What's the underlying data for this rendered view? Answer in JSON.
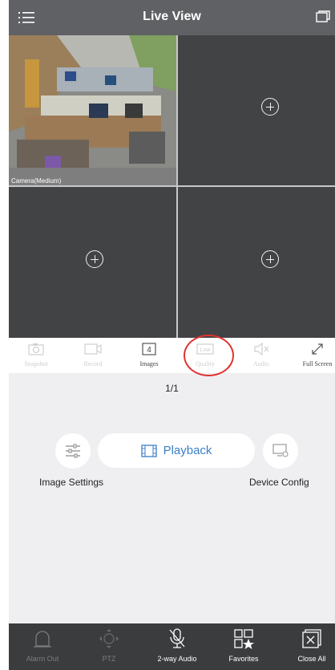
{
  "header": {
    "title": "Live View",
    "menu_icon": "menu-icon",
    "window_icon": "window-switch-icon"
  },
  "grid": {
    "cameras": [
      {
        "label": "Camera(Medium)",
        "has_video": true
      },
      {
        "label": "",
        "has_video": false
      },
      {
        "label": "",
        "has_video": false
      },
      {
        "label": "",
        "has_video": false
      }
    ]
  },
  "toolbar": {
    "snapshot": "Snapshot",
    "record": "Record",
    "images": "Images",
    "images_count": "4",
    "quality": "Quality",
    "quality_badge": "Low",
    "audio": "Audio",
    "fullscreen": "Full Screen"
  },
  "pager": {
    "text": "1/1"
  },
  "controls": {
    "image_settings": "Image Settings",
    "playback": "Playback",
    "device_config": "Device Config"
  },
  "bottom": {
    "alarm_out": "Alarm Out",
    "ptz": "PTZ",
    "two_way_audio": "2-way Audio",
    "favorites": "Favorites",
    "close_all": "Close All"
  },
  "colors": {
    "header": "#5f6164",
    "accent": "#3c7fc5",
    "highlight": "#e0332f",
    "bottom_bar": "#3b3c3e"
  }
}
